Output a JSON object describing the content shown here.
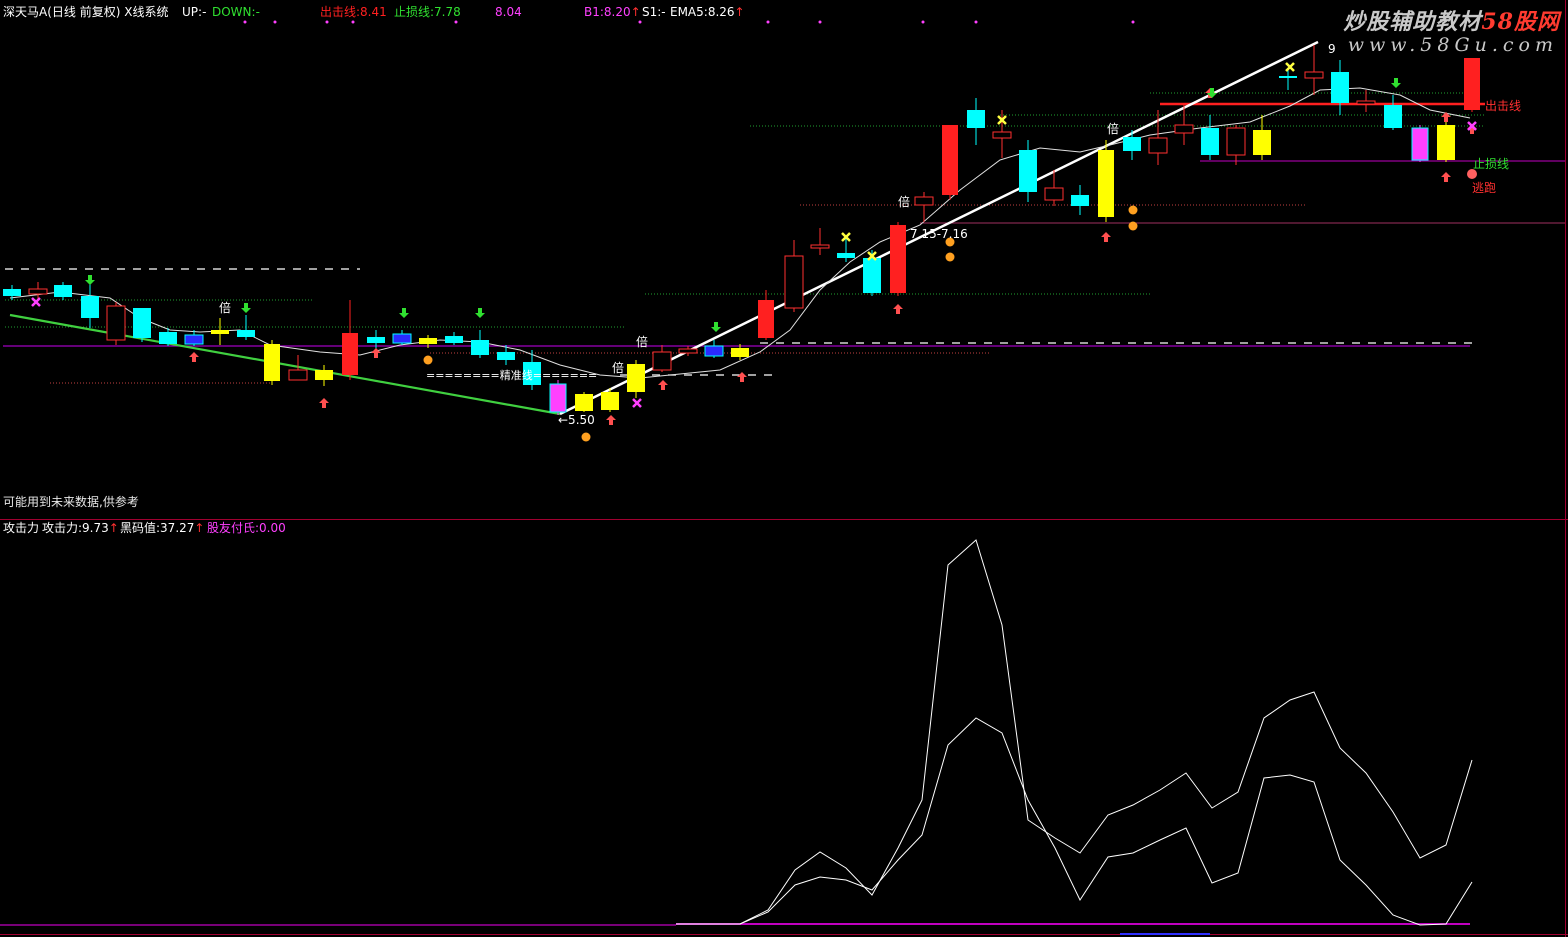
{
  "header": {
    "stock": "深天马A",
    "period": "(日线 前复权)",
    "system": "X线系统",
    "up_label": "UP:-",
    "down_label": "DOWN:-",
    "exit_label": "出击线:8.41",
    "stop_label": "止损线:7.78",
    "mid_value": "8.04",
    "b1_label": "B1:8.20",
    "b1_arrow": "↑",
    "s1_label": "S1:-",
    "ema_label": "EMA5:8.26",
    "ema_arrow": "↑"
  },
  "watermark": {
    "brand_prefix": "炒股辅助教材",
    "brand_red": "58股网",
    "url": "www.58Gu.com"
  },
  "main_chart": {
    "note": "可能用到未来数据,供参考",
    "labels": {
      "exit_line": "出击线",
      "stop_line": "止损线",
      "flee": "逃跑",
      "precise_line": "========精准线=======",
      "low_price": "←5.50",
      "range": "7.15-7.16",
      "top_mark": "9",
      "bei": "倍"
    }
  },
  "sub_chart": {
    "title": "攻击力",
    "attack_label": "攻击力:9.73",
    "attack_arrow": "↑",
    "black_code_label": "黑码值:37.27",
    "black_code_arrow": "↑",
    "retail_label": "股友付氏:0.00"
  },
  "colors": {
    "background": "#000000",
    "up_candle": "#ff3030",
    "down_candle": "#00ffff",
    "yellow_candle": "#ffff00",
    "magenta": "#ff40ff",
    "green": "#00ff40",
    "white_trend": "#ffffff",
    "panel_border": "#a00030"
  }
}
